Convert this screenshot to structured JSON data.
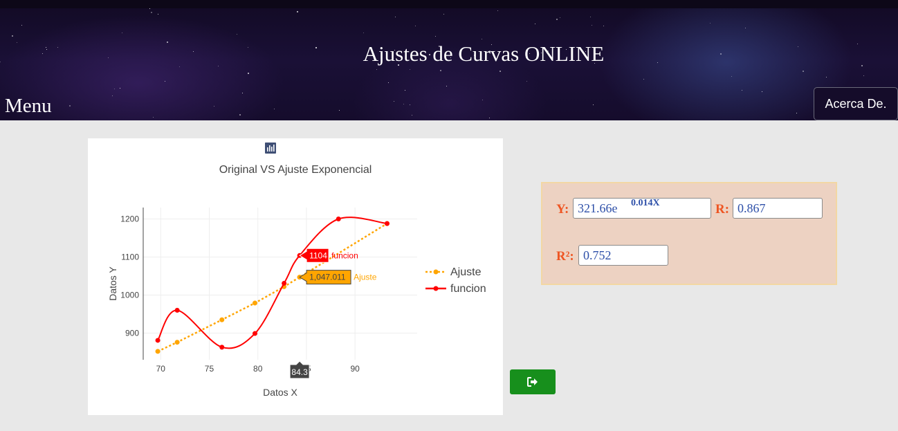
{
  "header": {
    "title": "Ajustes de Curvas ONLINE",
    "menu_label": "Menu",
    "about_button": "Acerca De."
  },
  "chart_data": {
    "type": "line",
    "title": "Original VS Ajuste Exponencial",
    "xlabel": "Datos  X",
    "ylabel": "Datos Y",
    "xlim": [
      68.2,
      96.4
    ],
    "ylim": [
      830,
      1230
    ],
    "x_ticks": [
      70,
      75,
      80,
      85,
      90
    ],
    "y_ticks": [
      900,
      1000,
      1100,
      1200
    ],
    "grid": true,
    "legend_position": "right",
    "series": [
      {
        "name": "Ajuste",
        "color": "#ffa500",
        "style": "dotted",
        "x": [
          69.7,
          71.7,
          76.3,
          79.7,
          82.7,
          84.3,
          93.3
        ],
        "y": [
          852,
          876,
          935,
          979,
          1022,
          1047.011,
          1188
        ]
      },
      {
        "name": "funcion",
        "color": "#ff0000",
        "style": "solid",
        "x": [
          69.7,
          71.7,
          76.3,
          79.7,
          82.7,
          84.3,
          88.3,
          93.3
        ],
        "y": [
          881,
          960,
          863,
          899,
          1031,
          1104,
          1200,
          1188
        ]
      }
    ],
    "hover": {
      "x_label": "84.3",
      "labels": [
        {
          "series": "funcion",
          "value": "1104",
          "name": "funcion"
        },
        {
          "series": "Ajuste",
          "value": "1,047.011",
          "name": "Ajuste"
        }
      ]
    }
  },
  "modebar": {
    "icons": [
      "camera-icon",
      "zoom-icon",
      "pan-icon",
      "box-select-icon",
      "lasso-icon",
      "zoom-in-icon",
      "zoom-out-icon",
      "autoscale-icon",
      "reset-axes-icon",
      "spike-lines-icon",
      "hover-closest-icon",
      "hover-compare-icon",
      "plotly-logo-icon"
    ]
  },
  "results": {
    "y_label": "Y:",
    "y_value": "321.66e",
    "y_exponent": "0.014X",
    "r_label": "R:",
    "r_value": "0.867",
    "r2_label": "R²:",
    "r2_value": "0.752"
  },
  "actions": {
    "go_icon": "sign-out-icon",
    "colors": {
      "go_button": "#178f1c",
      "panel_bg": "#edd2c2",
      "label": "#ee5522",
      "value": "#2d4fa8"
    }
  }
}
